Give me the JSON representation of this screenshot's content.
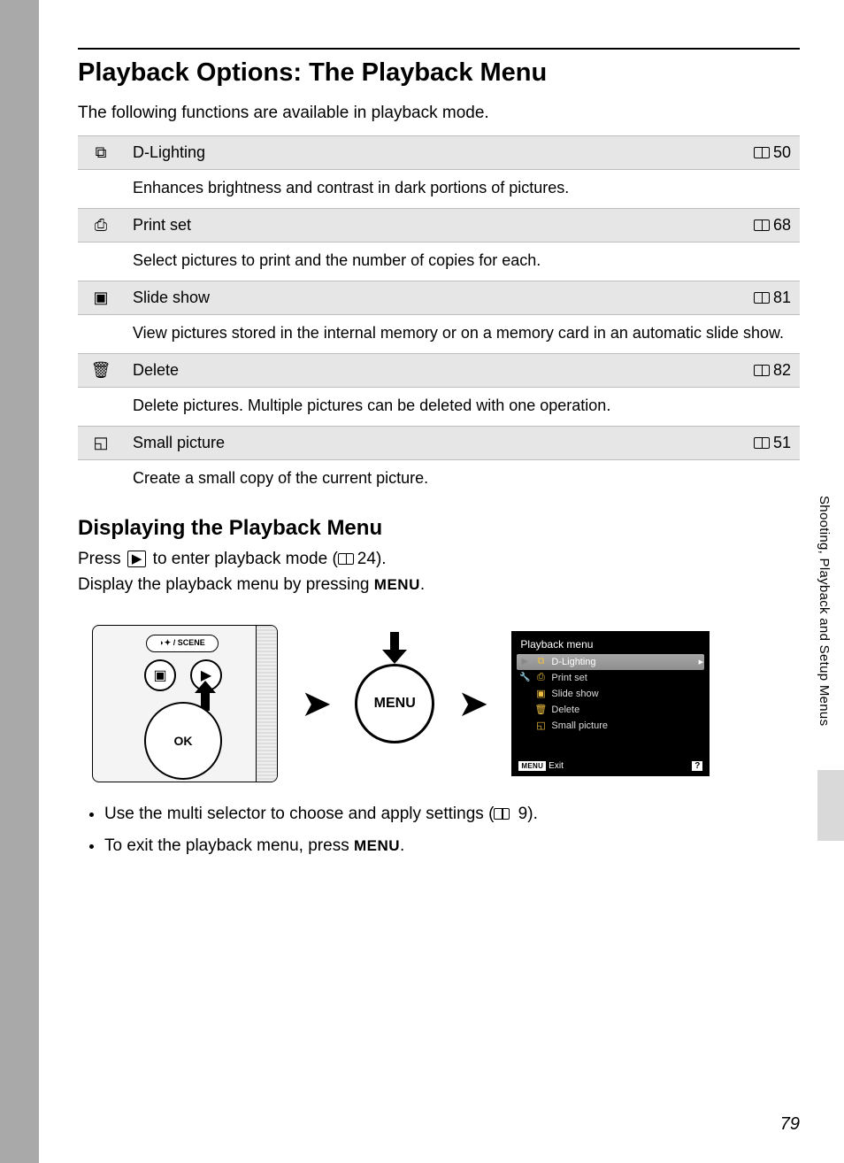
{
  "title": "Playback Options: The Playback Menu",
  "intro": "The following functions are available in playback mode.",
  "options": [
    {
      "icon": "⧉",
      "name": "D-Lighting",
      "page": "50",
      "desc": "Enhances brightness and contrast in dark portions of pictures."
    },
    {
      "icon": "⎙",
      "name": "Print set",
      "page": "68",
      "desc": "Select pictures to print and the number of copies for each."
    },
    {
      "icon": "▣",
      "name": "Slide show",
      "page": "81",
      "desc": "View pictures stored in the internal memory or on a memory card in an automatic slide show."
    },
    {
      "icon": "🗑",
      "name": "Delete",
      "page": "82",
      "desc": "Delete pictures. Multiple pictures can be deleted with one operation."
    },
    {
      "icon": "◱",
      "name": "Small picture",
      "page": "51",
      "desc": "Create a small copy of the current picture."
    }
  ],
  "subheading": "Displaying the Playback Menu",
  "press_prefix": "Press ",
  "press_mid": " to enter playback mode (",
  "press_page": "24",
  "press_suffix": ").",
  "display_prefix": "Display the playback menu by pressing ",
  "menu_label": "MENU",
  "display_suffix": ".",
  "camera": {
    "scene_label": "◗✦ / SCENE",
    "ok": "OK"
  },
  "screenmenu": {
    "title": "Playback menu",
    "items": [
      "D-Lighting",
      "Print set",
      "Slide show",
      "Delete",
      "Small picture"
    ],
    "exit": "Exit",
    "help": "?"
  },
  "bullets": [
    {
      "prefix": "Use the multi selector to choose and apply settings (",
      "page": "9",
      "suffix": ")."
    },
    {
      "prefix": "To exit the playback menu, press ",
      "menu": true,
      "suffix": "."
    }
  ],
  "side_label": "Shooting, Playback and Setup Menus",
  "page_number": "79"
}
